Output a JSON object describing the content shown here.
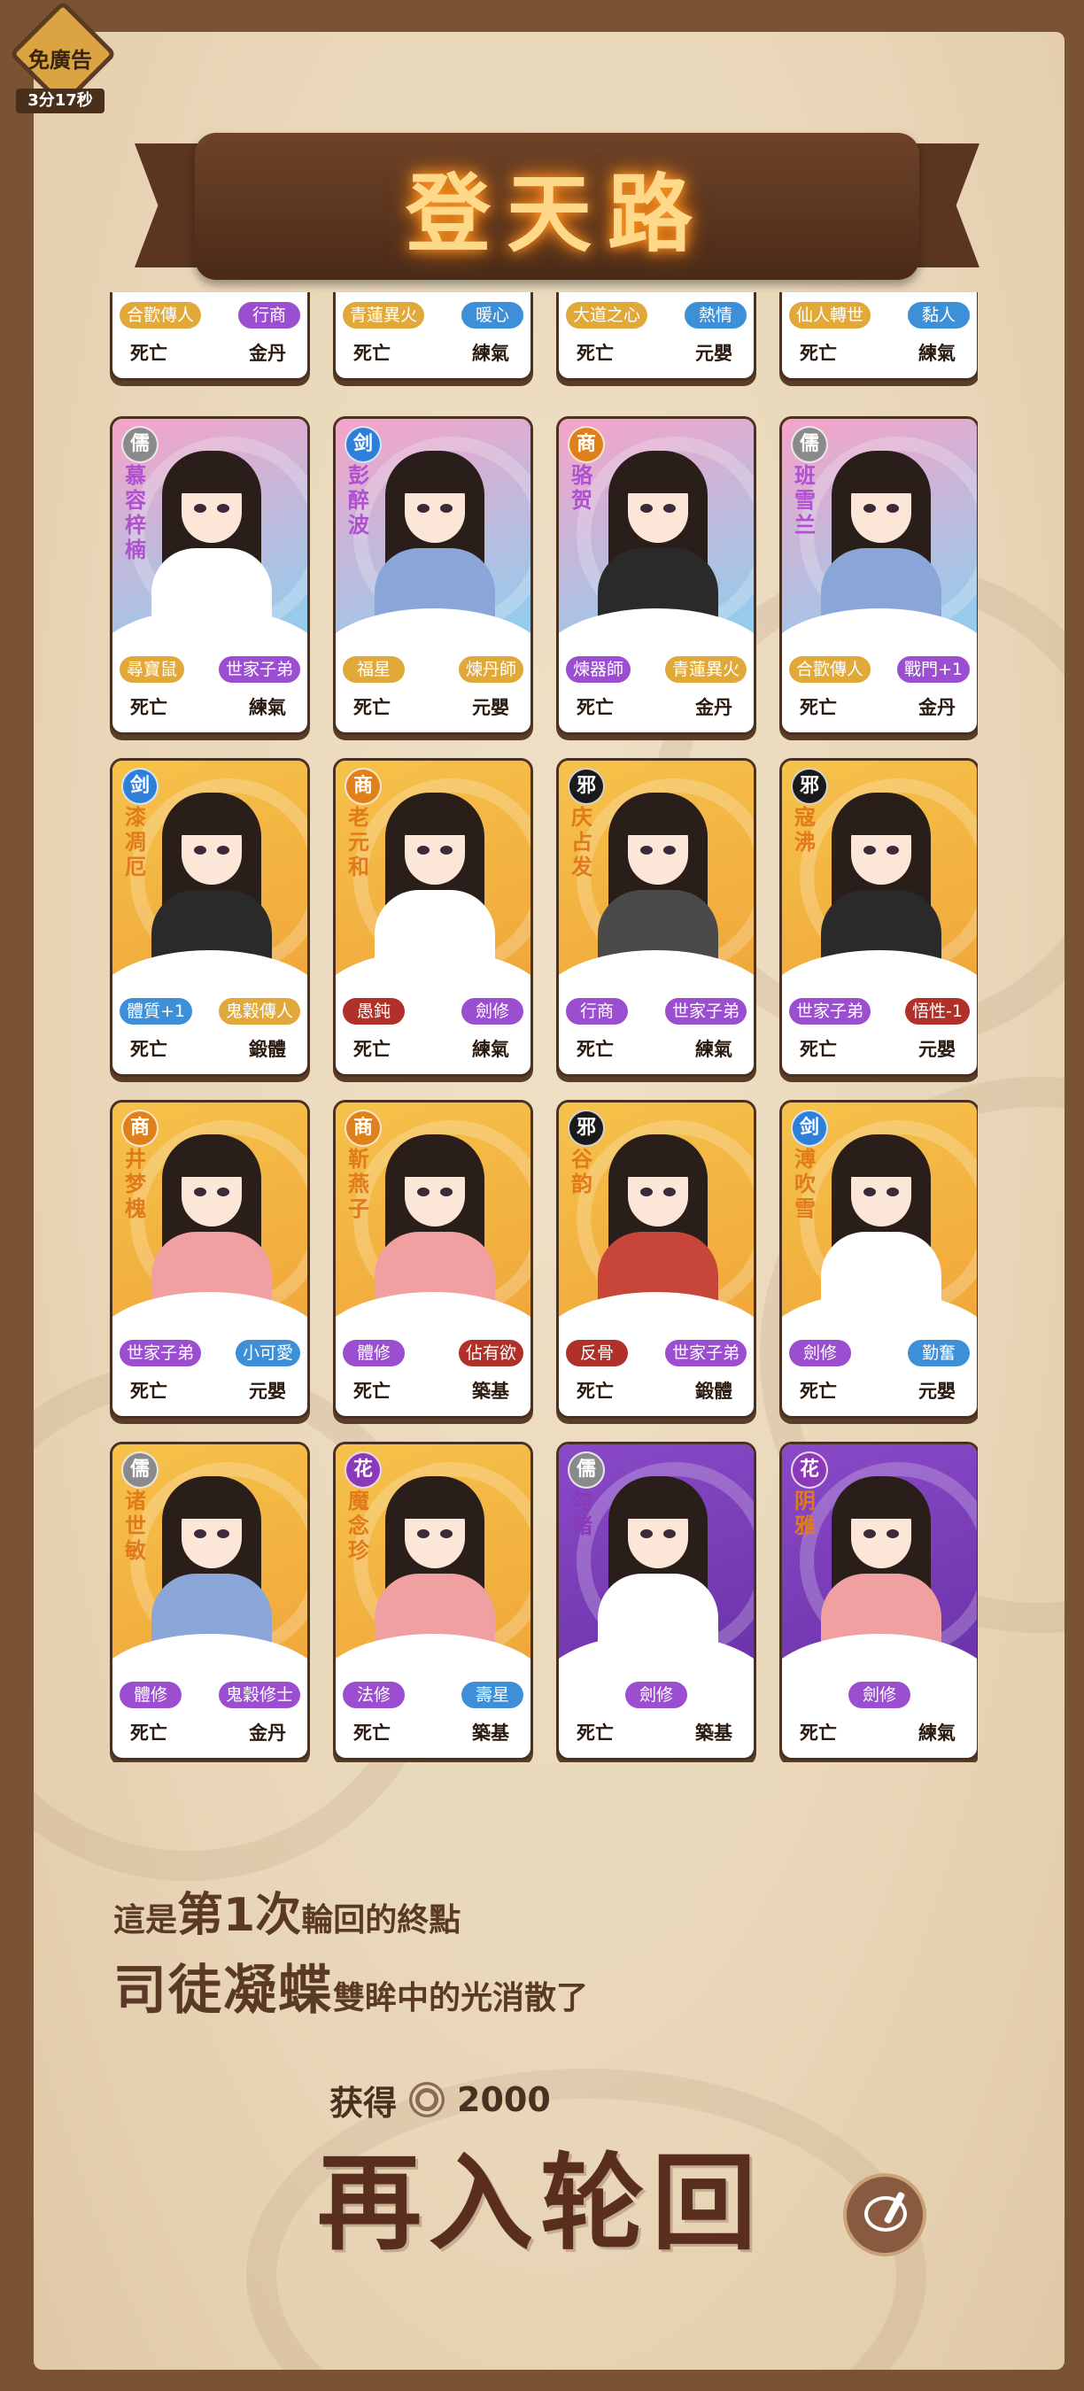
{
  "ad_badge": {
    "label": "免廣告",
    "timer": "3分17秒"
  },
  "title": "登天路",
  "cards": [
    {
      "sect": "",
      "name": "",
      "traits": [
        "合歡傳人",
        "行商"
      ],
      "trait_colors": [
        "#e0a93a",
        "#9b4fd0"
      ],
      "status": "死亡",
      "realm": "金丹",
      "bg": [
        "#f2c14b",
        "#e8a43a"
      ],
      "robe": "#2a1e1a",
      "name_color": "#000"
    },
    {
      "sect": "",
      "name": "",
      "traits": [
        "青蓮異火",
        "暖心"
      ],
      "trait_colors": [
        "#e0a93a",
        "#3d8fd8"
      ],
      "status": "死亡",
      "realm": "練氣",
      "bg": [
        "#f2c14b",
        "#e8a43a"
      ],
      "robe": "#cfd6e6",
      "name_color": "#000"
    },
    {
      "sect": "",
      "name": "",
      "traits": [
        "大道之心",
        "熱情"
      ],
      "trait_colors": [
        "#e0a93a",
        "#3d8fd8"
      ],
      "status": "死亡",
      "realm": "元嬰",
      "bg": [
        "#f2c14b",
        "#e8a43a"
      ],
      "robe": "#8aa6d8",
      "name_color": "#000"
    },
    {
      "sect": "",
      "name": "",
      "traits": [
        "仙人轉世",
        "黏人"
      ],
      "trait_colors": [
        "#e0a93a",
        "#3d8fd8"
      ],
      "status": "死亡",
      "realm": "練氣",
      "bg": [
        "#f2c14b",
        "#e8a43a"
      ],
      "robe": "#c8453a",
      "name_color": "#000"
    },
    {
      "sect": "儒",
      "sect_color": "#8a8a8a",
      "name": "慕容梓楠",
      "traits": [
        "尋寶鼠",
        "世家子弟"
      ],
      "trait_colors": [
        "#e0a93a",
        "#9b4fd0"
      ],
      "status": "死亡",
      "realm": "練氣",
      "bg": [
        "#f6a3c8",
        "#8ad0f0"
      ],
      "robe": "#ffffff",
      "name_color": "#b04fd0"
    },
    {
      "sect": "剑",
      "sect_color": "#2f7fd8",
      "name": "彭醉波",
      "traits": [
        "福星",
        "煉丹師"
      ],
      "trait_colors": [
        "#e0a93a",
        "#e0a93a"
      ],
      "status": "死亡",
      "realm": "元嬰",
      "bg": [
        "#f6a3c8",
        "#8ad0f0"
      ],
      "robe": "#8aa6d8",
      "name_color": "#b04fd0"
    },
    {
      "sect": "商",
      "sect_color": "#e0801a",
      "name": "骆贺",
      "traits": [
        "煉器師",
        "青蓮異火"
      ],
      "trait_colors": [
        "#9b4fd0",
        "#e0a93a"
      ],
      "status": "死亡",
      "realm": "金丹",
      "bg": [
        "#f6a3c8",
        "#8ad0f0"
      ],
      "robe": "#2a2a2a",
      "name_color": "#b04fd0"
    },
    {
      "sect": "儒",
      "sect_color": "#8a8a8a",
      "name": "班雪兰",
      "traits": [
        "合歡傳人",
        "戰門+1"
      ],
      "trait_colors": [
        "#e0a93a",
        "#9b4fd0"
      ],
      "status": "死亡",
      "realm": "金丹",
      "bg": [
        "#f6a3c8",
        "#8ad0f0"
      ],
      "robe": "#8aa6d8",
      "name_color": "#b04fd0"
    },
    {
      "sect": "剑",
      "sect_color": "#2f7fd8",
      "name": "漆凋厄",
      "traits": [
        "體質+1",
        "鬼穀傳人"
      ],
      "trait_colors": [
        "#3d8fd8",
        "#e0a93a"
      ],
      "status": "死亡",
      "realm": "鍛體",
      "bg": [
        "#f6c24a",
        "#f0a63a"
      ],
      "robe": "#2a2a2a",
      "name_color": "#e07a1a"
    },
    {
      "sect": "商",
      "sect_color": "#e0801a",
      "name": "老元和",
      "traits": [
        "愚鈍",
        "劍修"
      ],
      "trait_colors": [
        "#b0302a",
        "#9b4fd0"
      ],
      "status": "死亡",
      "realm": "練氣",
      "bg": [
        "#f6c24a",
        "#f0a63a"
      ],
      "robe": "#ffffff",
      "name_color": "#e07a1a"
    },
    {
      "sect": "邪",
      "sect_color": "#1a1a1a",
      "name": "庆占发",
      "traits": [
        "行商",
        "世家子弟"
      ],
      "trait_colors": [
        "#9b4fd0",
        "#9b4fd0"
      ],
      "status": "死亡",
      "realm": "練氣",
      "bg": [
        "#f6c24a",
        "#f0a63a"
      ],
      "robe": "#4a4a4a",
      "name_color": "#e07a1a"
    },
    {
      "sect": "邪",
      "sect_color": "#1a1a1a",
      "name": "寇沸",
      "traits": [
        "世家子弟",
        "悟性-1"
      ],
      "trait_colors": [
        "#9b4fd0",
        "#b0302a"
      ],
      "status": "死亡",
      "realm": "元嬰",
      "bg": [
        "#f6c24a",
        "#f0a63a"
      ],
      "robe": "#2a2a2a",
      "name_color": "#e07a1a"
    },
    {
      "sect": "商",
      "sect_color": "#e0801a",
      "name": "井梦槐",
      "traits": [
        "世家子弟",
        "小可愛"
      ],
      "trait_colors": [
        "#9b4fd0",
        "#3d8fd8"
      ],
      "status": "死亡",
      "realm": "元嬰",
      "bg": [
        "#f6c24a",
        "#f0a63a"
      ],
      "robe": "#f0a0a0",
      "name_color": "#e07a1a"
    },
    {
      "sect": "商",
      "sect_color": "#e0801a",
      "name": "靳燕子",
      "traits": [
        "體修",
        "佔有欲"
      ],
      "trait_colors": [
        "#9b4fd0",
        "#b0302a"
      ],
      "status": "死亡",
      "realm": "築基",
      "bg": [
        "#f6c24a",
        "#f0a63a"
      ],
      "robe": "#f0a0a0",
      "name_color": "#e07a1a"
    },
    {
      "sect": "邪",
      "sect_color": "#1a1a1a",
      "name": "谷韵",
      "traits": [
        "反骨",
        "世家子弟"
      ],
      "trait_colors": [
        "#b0302a",
        "#9b4fd0"
      ],
      "status": "死亡",
      "realm": "鍛體",
      "bg": [
        "#f6c24a",
        "#f0a63a"
      ],
      "robe": "#c8453a",
      "name_color": "#e07a1a"
    },
    {
      "sect": "剑",
      "sect_color": "#2f7fd8",
      "name": "溥吹雪",
      "traits": [
        "劍修",
        "勤奮"
      ],
      "trait_colors": [
        "#9b4fd0",
        "#3d8fd8"
      ],
      "status": "死亡",
      "realm": "元嬰",
      "bg": [
        "#f6c24a",
        "#f0a63a"
      ],
      "robe": "#ffffff",
      "name_color": "#e07a1a"
    },
    {
      "sect": "儒",
      "sect_color": "#8a8a8a",
      "name": "诸世敏",
      "traits": [
        "體修",
        "鬼穀修士"
      ],
      "trait_colors": [
        "#9b4fd0",
        "#9b4fd0"
      ],
      "status": "死亡",
      "realm": "金丹",
      "bg": [
        "#f6c24a",
        "#f0a63a"
      ],
      "robe": "#8aa6d8",
      "name_color": "#e07a1a"
    },
    {
      "sect": "花",
      "sect_color": "#8a3ab8",
      "name": "魔念珍",
      "traits": [
        "法修",
        "壽星"
      ],
      "trait_colors": [
        "#9b4fd0",
        "#3d8fd8"
      ],
      "status": "死亡",
      "realm": "築基",
      "bg": [
        "#f6c24a",
        "#f0a63a"
      ],
      "robe": "#f0a0a0",
      "name_color": "#e07a1a"
    },
    {
      "sect": "儒",
      "sect_color": "#8a8a8a",
      "name": "勾褚",
      "traits": [
        "劍修"
      ],
      "trait_colors": [
        "#9b4fd0"
      ],
      "status": "死亡",
      "realm": "築基",
      "bg": [
        "#8a4ac8",
        "#6a32a8"
      ],
      "robe": "#ffffff",
      "name_color": "#8a3ab8"
    },
    {
      "sect": "花",
      "sect_color": "#8a3ab8",
      "name": "阴雅",
      "traits": [
        "劍修"
      ],
      "trait_colors": [
        "#9b4fd0"
      ],
      "status": "死亡",
      "realm": "練氣",
      "bg": [
        "#8a4ac8",
        "#6a32a8"
      ],
      "robe": "#f0a0a0",
      "name_color": "#e07a1a"
    }
  ],
  "result": {
    "line1_pre": "這是",
    "line1_big": "第1次",
    "line1_post": "輪回的終點",
    "line2_big": "司徒凝蝶",
    "line2_post": "雙眸中的光消散了"
  },
  "reward": {
    "label": "获得",
    "currency_icon": "spiral-coin-icon",
    "amount": "2000"
  },
  "reincarnate_label": "再入轮回",
  "share_icon": "chat-pen-icon"
}
